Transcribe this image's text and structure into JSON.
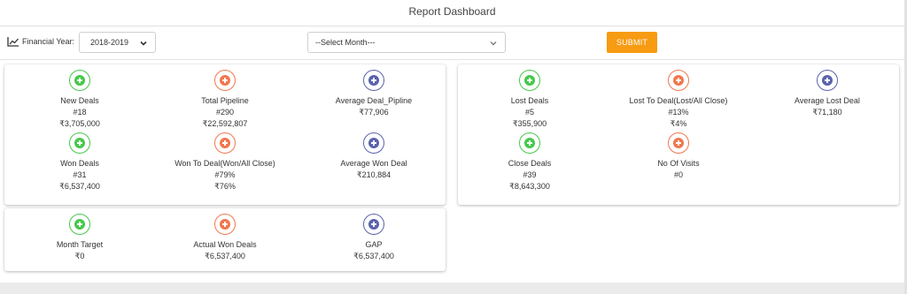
{
  "header": {
    "title": "Report Dashboard"
  },
  "filters": {
    "financial_year_label": "Financial Year:",
    "financial_year_value": "2018-2019",
    "month_value": "--Select Month---",
    "submit_label": "SUBMIT"
  },
  "colors": {
    "green": "#46c84b",
    "orange": "#f0774d",
    "blue": "#5b62ad",
    "submit": "#f79b13"
  },
  "card1": {
    "new_deals": {
      "label": "New Deals",
      "line1": "#18",
      "line2": "₹3,705,000",
      "icon": "plus-circle-icon"
    },
    "total_pipeline": {
      "label": "Total Pipeline",
      "line1": "#290",
      "line2": "₹22,592,807",
      "icon": "plus-circle-icon"
    },
    "avg_deal_pipeline": {
      "label": "Average Deal_Pipline",
      "line1": "₹77,906",
      "icon": "plus-circle-icon"
    },
    "won_deals": {
      "label": "Won Deals",
      "line1": "#31",
      "line2": "₹6,537,400",
      "icon": "plus-circle-icon"
    },
    "won_to_deal": {
      "label": "Won To Deal(Won/All Close)",
      "line1": "#79%",
      "line2": "₹76%",
      "icon": "plus-circle-icon"
    },
    "avg_won_deal": {
      "label": "Average Won Deal",
      "line1": "₹210,884",
      "icon": "plus-circle-icon"
    }
  },
  "card2": {
    "lost_deals": {
      "label": "Lost Deals",
      "line1": "#5",
      "line2": "₹355,900",
      "icon": "plus-circle-icon"
    },
    "lost_to_deal": {
      "label": "Lost To Deal(Lost/All Close)",
      "line1": "#13%",
      "line2": "₹4%",
      "icon": "plus-circle-icon"
    },
    "avg_lost_deal": {
      "label": "Average Lost Deal",
      "line1": "₹71,180",
      "icon": "plus-circle-icon"
    },
    "close_deals": {
      "label": "Close Deals",
      "line1": "#39",
      "line2": "₹8,643,300",
      "icon": "plus-circle-icon"
    },
    "no_of_visits": {
      "label": "No Of Visits",
      "line1": "#0",
      "icon": "plus-circle-icon"
    }
  },
  "card3": {
    "month_target": {
      "label": "Month Target",
      "line1": "₹0",
      "icon": "plus-circle-icon"
    },
    "actual_won_deals": {
      "label": "Actual Won Deals",
      "line1": "₹6,537,400",
      "icon": "plus-circle-icon"
    },
    "gap": {
      "label": "GAP",
      "line1": "₹6,537,400",
      "icon": "plus-circle-icon"
    }
  }
}
